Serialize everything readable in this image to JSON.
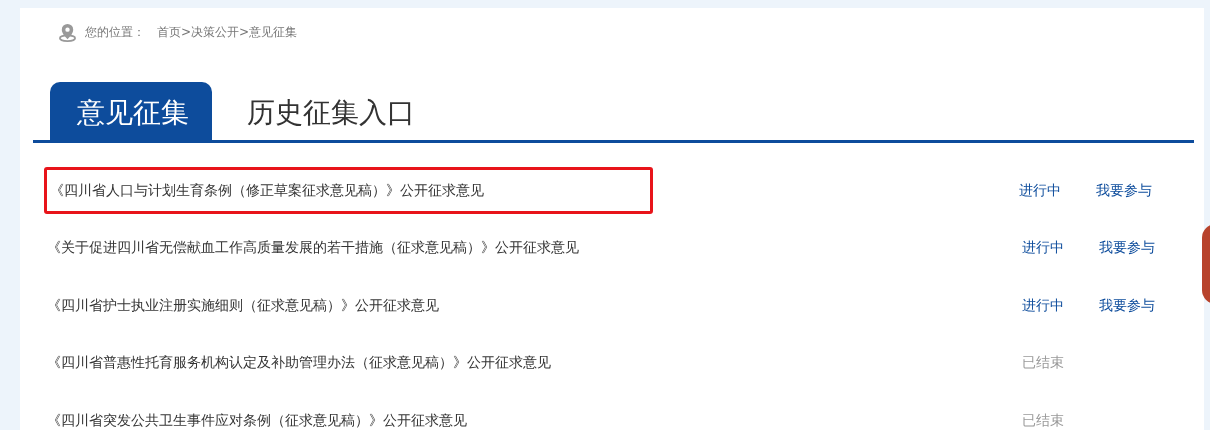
{
  "breadcrumb": {
    "label": "您的位置：",
    "path": "首页>决策公开>意见征集"
  },
  "tabs": [
    {
      "label": "意见征集",
      "selected": true
    },
    {
      "label": "历史征集入口",
      "selected": false
    }
  ],
  "items": [
    {
      "title": "《四川省人口与计划生育条例（修正草案征求意见稿）》公开征求意见",
      "status": "进行中",
      "ongoing": true,
      "action": "我要参与",
      "highlighted": true
    },
    {
      "title": "《关于促进四川省无偿献血工作高质量发展的若干措施（征求意见稿）》公开征求意见",
      "status": "进行中",
      "ongoing": true,
      "action": "我要参与",
      "highlighted": false
    },
    {
      "title": "《四川省护士执业注册实施细则（征求意见稿）》公开征求意见",
      "status": "进行中",
      "ongoing": true,
      "action": "我要参与",
      "highlighted": false
    },
    {
      "title": "《四川省普惠性托育服务机构认定及补助管理办法（征求意见稿）》公开征求意见",
      "status": "已结束",
      "ongoing": false,
      "highlighted": false
    },
    {
      "title": "《四川省突发公共卫生事件应对条例（征求意见稿）》公开征求意见",
      "status": "已结束",
      "ongoing": false,
      "highlighted": false
    }
  ]
}
